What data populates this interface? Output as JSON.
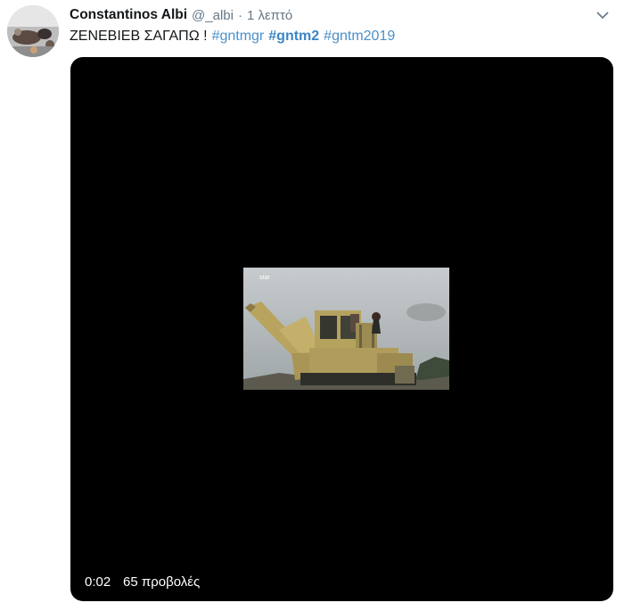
{
  "tweet": {
    "author_name": "Constantinos Albi",
    "author_handle": "@_albi",
    "separator": "·",
    "timestamp": "1 λεπτό",
    "text_main": "ΖΕΝΕΒΙΕΒ ΣΑΓΑΠΩ !",
    "hashtags": [
      {
        "text": "#gntmgr",
        "bold": false
      },
      {
        "text": "#gntm2",
        "bold": true
      },
      {
        "text": "#gntm2019",
        "bold": false
      }
    ],
    "hashtag_color": "#4a90c9"
  },
  "video": {
    "elapsed": "0:02",
    "views": "65 προβολές",
    "channel_watermark": "star"
  },
  "icons": {
    "avatar": "avatar-photo",
    "menu": "chevron-down-icon"
  }
}
